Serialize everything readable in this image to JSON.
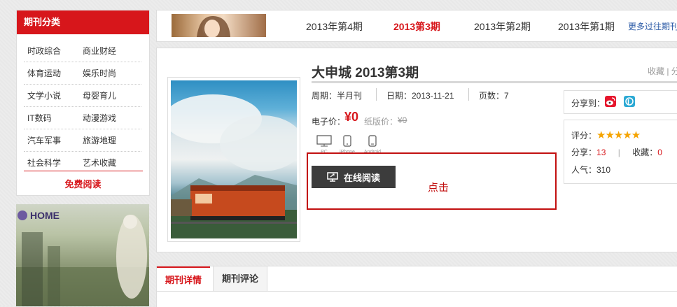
{
  "sidebar": {
    "title": "期刊分类",
    "categories": [
      [
        "时政综合",
        "商业财经"
      ],
      [
        "体育运动",
        "娱乐时尚"
      ],
      [
        "文学小说",
        "母婴育儿"
      ],
      [
        "IT数码",
        "动漫游戏"
      ],
      [
        "汽车军事",
        "旅游地理"
      ],
      [
        "社会科学",
        "艺术收藏"
      ]
    ],
    "free_read": "免费阅读",
    "banner_label": "HOME"
  },
  "issues_bar": {
    "issues": [
      "2013年第4期",
      "2013第3期",
      "2013年第2期",
      "2013年第1期"
    ],
    "active_index": 1,
    "more_link": "更多过往期刊"
  },
  "product": {
    "title": "大申城 2013第3期",
    "fav_share": "收藏 | 分",
    "period": "周期：半月刊",
    "date": "日期：2013-11-21",
    "pages": "页数：7",
    "e_price_label": "电子价：",
    "e_price_value": "¥0",
    "paper_price_label": "纸版价：",
    "paper_price_value": "¥0",
    "devices": [
      "PC",
      "iPhone",
      "Android"
    ],
    "read_button": "在线阅读",
    "click_hint": "点击"
  },
  "share": {
    "label": "分享到：",
    "icons": [
      "weibo-icon",
      "p-icon"
    ]
  },
  "stats": {
    "rating_label": "评分：",
    "rating_stars": 5,
    "share_label": "分享：",
    "share_count": "13",
    "fav_label": "收藏：",
    "fav_count": "0",
    "popularity": "人气：310"
  },
  "tabs": [
    "期刊详情",
    "期刊评论"
  ],
  "colors": {
    "accent": "#d7161b",
    "button": "#3c3c3c",
    "link": "#2b5aa6",
    "star": "#f5a400"
  }
}
